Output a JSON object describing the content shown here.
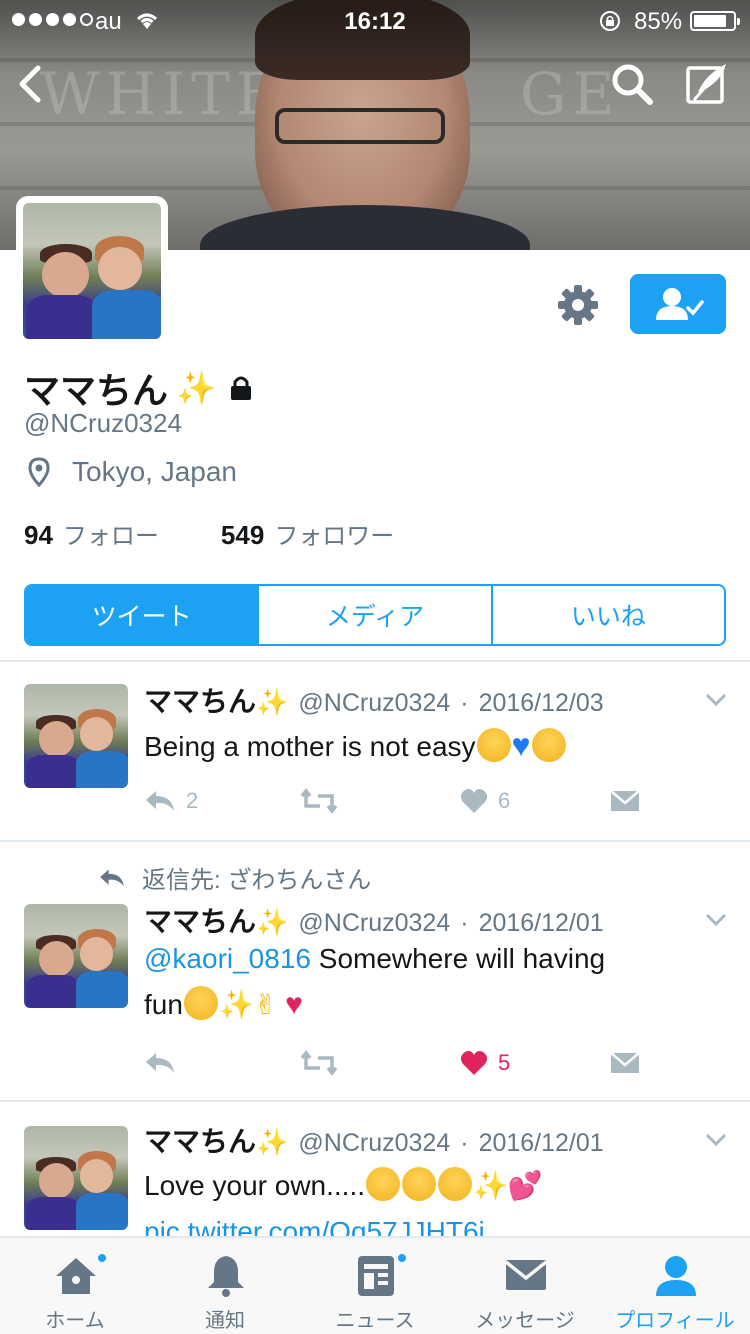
{
  "status_bar": {
    "carrier": "au",
    "time": "16:12",
    "battery_percent": "85%",
    "battery_level": 0.85
  },
  "profile": {
    "name": "ママちん",
    "handle": "@NCruz0324",
    "location": "Tokyo, Japan",
    "following_count": "94",
    "following_label": "フォロー",
    "followers_count": "549",
    "followers_label": "フォロワー"
  },
  "tabs": [
    {
      "label": "ツイート",
      "active": true
    },
    {
      "label": "メディア",
      "active": false
    },
    {
      "label": "いいね",
      "active": false
    }
  ],
  "tweets": [
    {
      "name": "ママちん",
      "handle": "@NCruz0324",
      "date": "2016/12/03",
      "text": "Being a mother is not easy",
      "reply_count": "2",
      "like_count": "6",
      "liked": false
    },
    {
      "reply_context_label": "返信先: ざわちんさん",
      "name": "ママちん",
      "handle": "@NCruz0324",
      "date": "2016/12/01",
      "mention": "@kaori_0816",
      "text": " Somewhere will  having",
      "text_line2": "fun",
      "reply_count": "",
      "like_count": "5",
      "liked": true
    },
    {
      "name": "ママちん",
      "handle": "@NCruz0324",
      "date": "2016/12/01",
      "text": "Love your own.....",
      "link": "pic.twitter.com/Qq57JJHT6i"
    }
  ],
  "tabbar": [
    {
      "label": "ホーム",
      "icon": "home-icon",
      "badge": true,
      "active": false
    },
    {
      "label": "通知",
      "icon": "bell-icon",
      "badge": false,
      "active": false
    },
    {
      "label": "ニュース",
      "icon": "news-icon",
      "badge": true,
      "active": false
    },
    {
      "label": "メッセージ",
      "icon": "envelope-icon",
      "badge": false,
      "active": false
    },
    {
      "label": "プロフィール",
      "icon": "person-icon",
      "badge": false,
      "active": true
    }
  ],
  "colors": {
    "accent": "#1da1f2",
    "like": "#e0245e",
    "muted": "#657786"
  }
}
